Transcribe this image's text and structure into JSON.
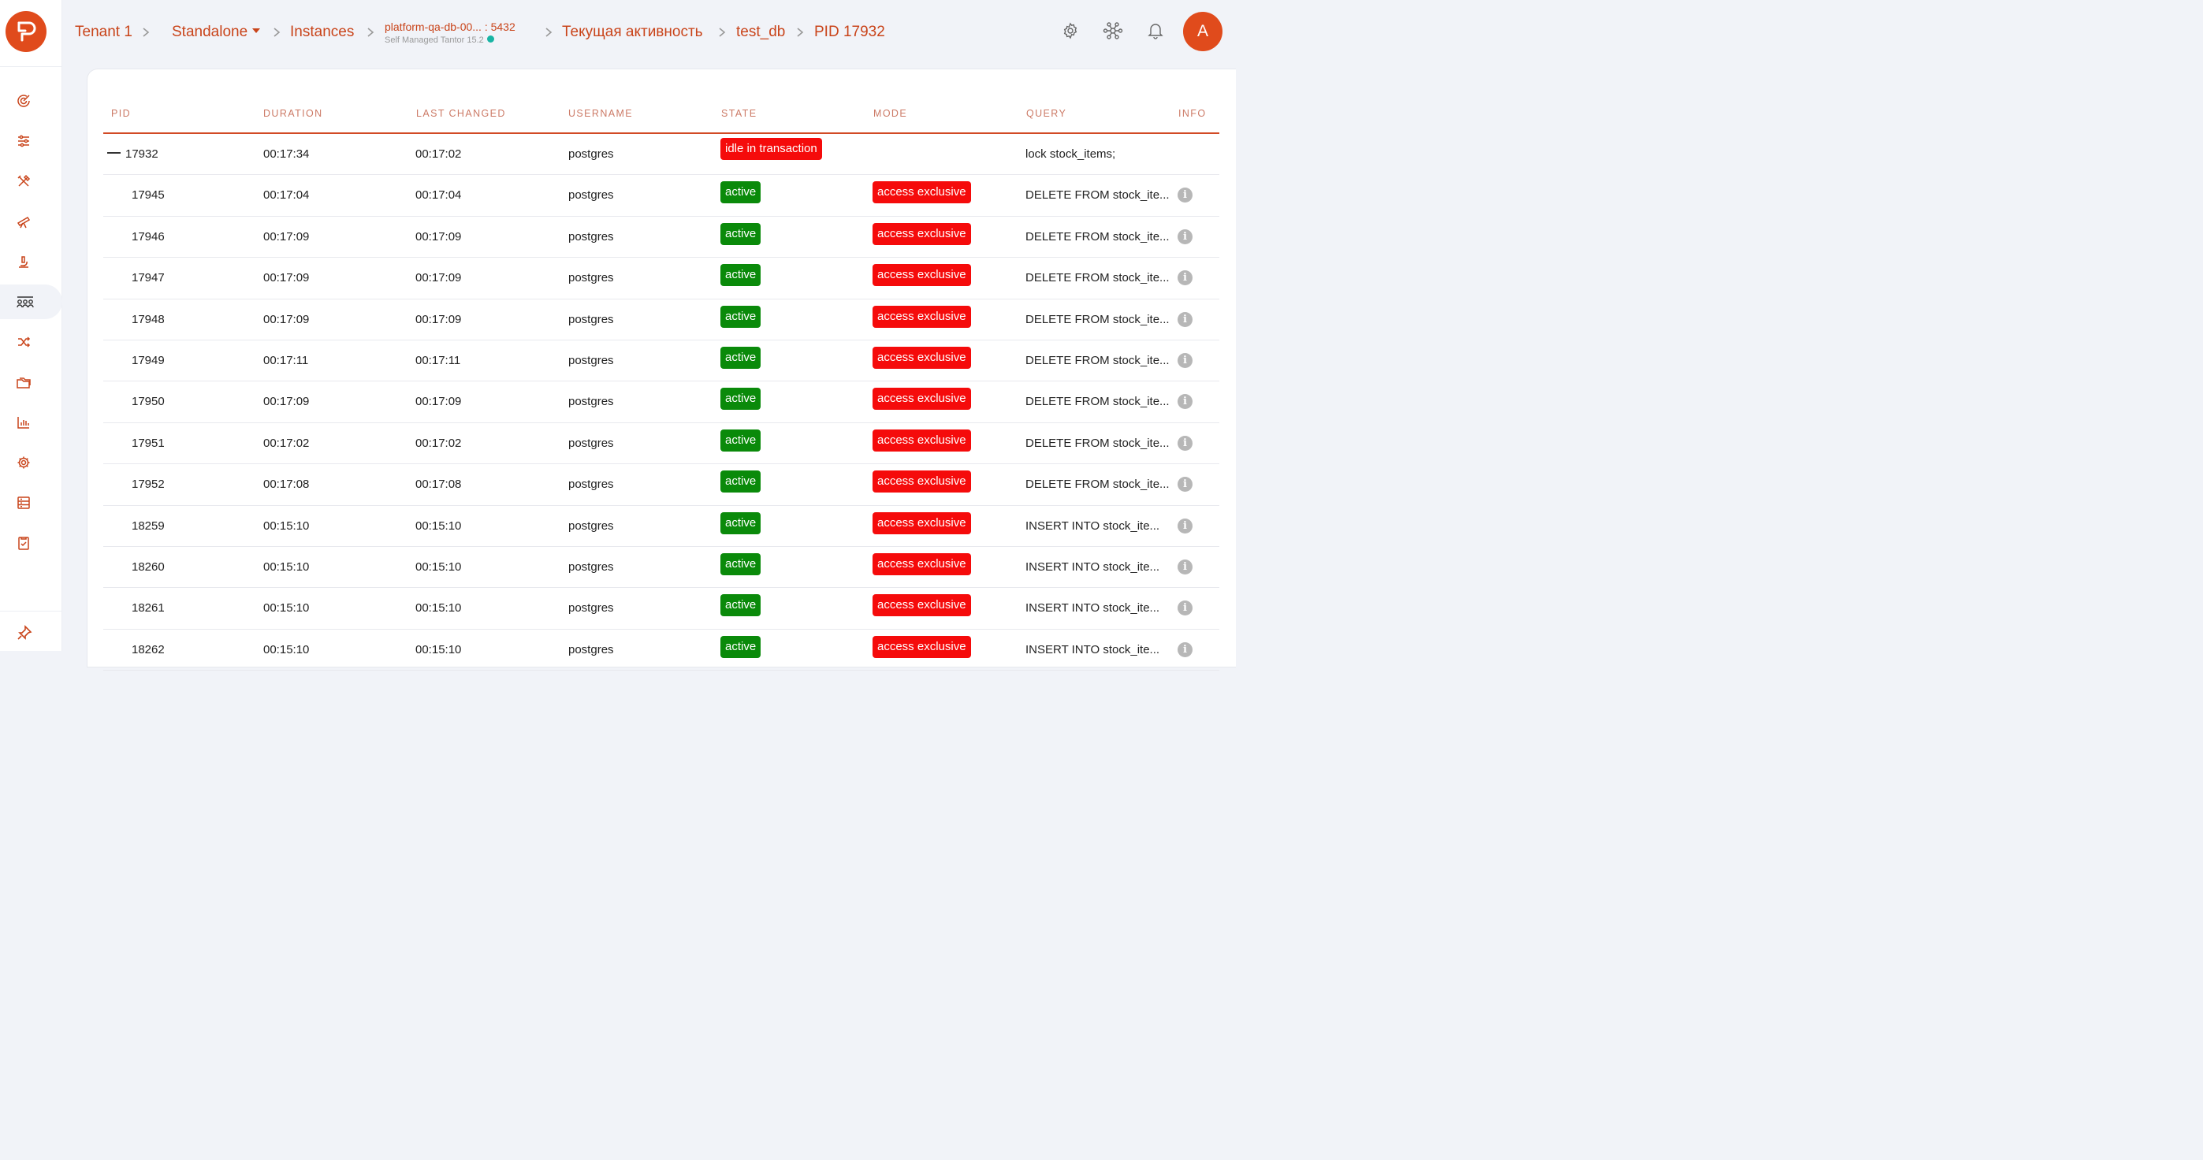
{
  "breadcrumb": {
    "tenant": "Tenant 1",
    "mode": "Standalone",
    "instances": "Instances",
    "instance_host": "platform-qa-db-00... : 5432",
    "instance_subtitle": "Self Managed Tantor 15.2",
    "activity": "Текущая активность",
    "database": "test_db",
    "pid": "PID 17932"
  },
  "user": {
    "avatar_initial": "A"
  },
  "colors": {
    "brand": "#e04b1c",
    "active_badge": "#0a8a0a",
    "alert_badge": "#f50b0b",
    "online_dot": "#18b4a4"
  },
  "sidebar": {
    "items": [
      {
        "icon": "dashboard-gauge-icon"
      },
      {
        "icon": "sliders-icon"
      },
      {
        "icon": "tools-icon"
      },
      {
        "icon": "telescope-icon"
      },
      {
        "icon": "microscope-icon"
      },
      {
        "icon": "sessions-icon",
        "active": true
      },
      {
        "icon": "shuffle-icon"
      },
      {
        "icon": "folders-icon"
      },
      {
        "icon": "bar-chart-icon"
      },
      {
        "icon": "gear-icon"
      },
      {
        "icon": "storage-icon"
      },
      {
        "icon": "checklist-icon"
      }
    ],
    "pin_icon": "pin-icon"
  },
  "header_icons": [
    "settings-icon",
    "topology-icon",
    "bell-icon"
  ],
  "table": {
    "columns": [
      "PID",
      "DURATION",
      "LAST CHANGED",
      "USERNAME",
      "STATE",
      "MODE",
      "QUERY",
      "INFO"
    ],
    "rows": [
      {
        "pid": "17932",
        "duration": "00:17:34",
        "last_changed": "00:17:02",
        "username": "postgres",
        "state": "idle in transaction",
        "mode": "",
        "query": "lock stock_items;",
        "parent": true
      },
      {
        "pid": "17945",
        "duration": "00:17:04",
        "last_changed": "00:17:04",
        "username": "postgres",
        "state": "active",
        "mode": "access exclusive",
        "query": "DELETE FROM stock_ite..."
      },
      {
        "pid": "17946",
        "duration": "00:17:09",
        "last_changed": "00:17:09",
        "username": "postgres",
        "state": "active",
        "mode": "access exclusive",
        "query": "DELETE FROM stock_ite..."
      },
      {
        "pid": "17947",
        "duration": "00:17:09",
        "last_changed": "00:17:09",
        "username": "postgres",
        "state": "active",
        "mode": "access exclusive",
        "query": "DELETE FROM stock_ite..."
      },
      {
        "pid": "17948",
        "duration": "00:17:09",
        "last_changed": "00:17:09",
        "username": "postgres",
        "state": "active",
        "mode": "access exclusive",
        "query": "DELETE FROM stock_ite..."
      },
      {
        "pid": "17949",
        "duration": "00:17:11",
        "last_changed": "00:17:11",
        "username": "postgres",
        "state": "active",
        "mode": "access exclusive",
        "query": "DELETE FROM stock_ite..."
      },
      {
        "pid": "17950",
        "duration": "00:17:09",
        "last_changed": "00:17:09",
        "username": "postgres",
        "state": "active",
        "mode": "access exclusive",
        "query": "DELETE FROM stock_ite..."
      },
      {
        "pid": "17951",
        "duration": "00:17:02",
        "last_changed": "00:17:02",
        "username": "postgres",
        "state": "active",
        "mode": "access exclusive",
        "query": "DELETE FROM stock_ite..."
      },
      {
        "pid": "17952",
        "duration": "00:17:08",
        "last_changed": "00:17:08",
        "username": "postgres",
        "state": "active",
        "mode": "access exclusive",
        "query": "DELETE FROM stock_ite..."
      },
      {
        "pid": "18259",
        "duration": "00:15:10",
        "last_changed": "00:15:10",
        "username": "postgres",
        "state": "active",
        "mode": "access exclusive",
        "query": "INSERT INTO stock_ite..."
      },
      {
        "pid": "18260",
        "duration": "00:15:10",
        "last_changed": "00:15:10",
        "username": "postgres",
        "state": "active",
        "mode": "access exclusive",
        "query": "INSERT INTO stock_ite..."
      },
      {
        "pid": "18261",
        "duration": "00:15:10",
        "last_changed": "00:15:10",
        "username": "postgres",
        "state": "active",
        "mode": "access exclusive",
        "query": "INSERT INTO stock_ite..."
      },
      {
        "pid": "18262",
        "duration": "00:15:10",
        "last_changed": "00:15:10",
        "username": "postgres",
        "state": "active",
        "mode": "access exclusive",
        "query": "INSERT INTO stock_ite..."
      }
    ],
    "info_glyph": "i"
  }
}
